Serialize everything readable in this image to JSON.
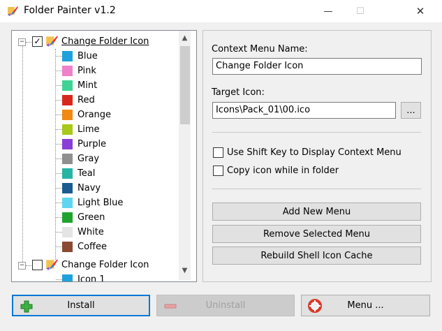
{
  "window": {
    "title": "Folder Painter v1.2",
    "min_glyph": "—",
    "max_glyph": "☐",
    "close_glyph": "✕"
  },
  "tree": {
    "group1": {
      "label": "Change Folder Icon",
      "checked": true,
      "expander": "−",
      "items": [
        {
          "label": "Blue",
          "color": "#1fa2db"
        },
        {
          "label": "Pink",
          "color": "#ee82c8"
        },
        {
          "label": "Mint",
          "color": "#3fd494"
        },
        {
          "label": "Red",
          "color": "#d8281d"
        },
        {
          "label": "Orange",
          "color": "#ef8a14"
        },
        {
          "label": "Lime",
          "color": "#a8c81a"
        },
        {
          "label": "Purple",
          "color": "#8b3ed6"
        },
        {
          "label": "Gray",
          "color": "#8f8f8f"
        },
        {
          "label": "Teal",
          "color": "#27b4a5"
        },
        {
          "label": "Navy",
          "color": "#1c5b8f"
        },
        {
          "label": "Light Blue",
          "color": "#5fd6f0"
        },
        {
          "label": "Green",
          "color": "#1fa32e"
        },
        {
          "label": "White",
          "color": "#e4e4e4"
        },
        {
          "label": "Coffee",
          "color": "#8a4a32"
        }
      ]
    },
    "group2": {
      "label": "Change Folder Icon",
      "checked": false,
      "expander": "−",
      "items": [
        {
          "label": "Icon 1",
          "color": "#1fa2db"
        }
      ]
    },
    "scroll_up_glyph": "▲",
    "scroll_down_glyph": "▼"
  },
  "settings": {
    "context_menu_name_label": "Context Menu Name:",
    "context_menu_name_value": "Change Folder Icon",
    "target_icon_label": "Target Icon:",
    "target_icon_value": "Icons\\Pack_01\\00.ico",
    "browse_label": "...",
    "use_shift_key_label": "Use Shift Key to Display Context Menu",
    "use_shift_key_checked": false,
    "copy_icon_label": "Copy icon while in folder",
    "copy_icon_checked": false,
    "add_new_menu_label": "Add New Menu",
    "remove_selected_menu_label": "Remove Selected Menu",
    "rebuild_cache_label": "Rebuild Shell Icon Cache"
  },
  "actions": {
    "install_label": "Install",
    "install_icon": "plus-icon",
    "uninstall_label": "Uninstall",
    "uninstall_icon": "minus-icon",
    "menu_label": "Menu ...",
    "menu_icon": "lifebuoy-icon"
  }
}
